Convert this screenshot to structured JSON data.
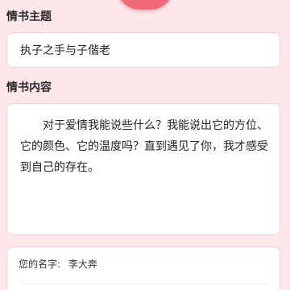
{
  "form": {
    "title_label": "情书主题",
    "title_value": "执子之手与子偕老",
    "content_label": "情书内容",
    "content_value": "对于爱情我能说些什么？我能说出它的方位、它的颜色、它的温度吗？直到遇见了你，我才感受到自己的存在。",
    "name_label": "您的名字:",
    "name_value": "李大奔"
  },
  "colors": {
    "background": "#fde7ea",
    "accent": "#f06a79",
    "card": "#ffffff"
  }
}
